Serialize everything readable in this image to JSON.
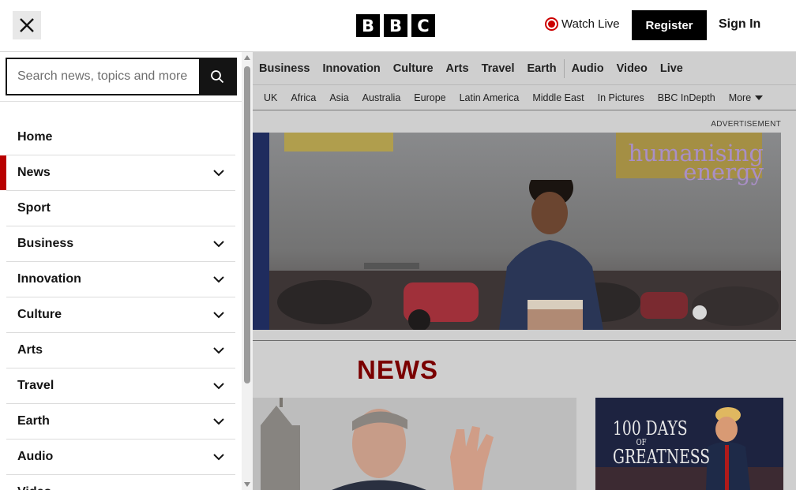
{
  "header": {
    "logo_letters": [
      "B",
      "B",
      "C"
    ],
    "watch_live": "Watch Live",
    "register": "Register",
    "sign_in": "Sign In"
  },
  "search": {
    "placeholder": "Search news, topics and more"
  },
  "menu": {
    "items": [
      {
        "label": "Home",
        "expandable": false,
        "active": false
      },
      {
        "label": "News",
        "expandable": true,
        "active": true
      },
      {
        "label": "Sport",
        "expandable": false,
        "active": false
      },
      {
        "label": "Business",
        "expandable": true,
        "active": false
      },
      {
        "label": "Innovation",
        "expandable": true,
        "active": false
      },
      {
        "label": "Culture",
        "expandable": true,
        "active": false
      },
      {
        "label": "Arts",
        "expandable": true,
        "active": false
      },
      {
        "label": "Travel",
        "expandable": true,
        "active": false
      },
      {
        "label": "Earth",
        "expandable": true,
        "active": false
      },
      {
        "label": "Audio",
        "expandable": true,
        "active": false
      },
      {
        "label": "Video",
        "expandable": false,
        "active": false
      }
    ]
  },
  "nav_primary": [
    "Business",
    "Innovation",
    "Culture",
    "Arts",
    "Travel",
    "Earth",
    "Audio",
    "Video",
    "Live"
  ],
  "nav_secondary": [
    "UK",
    "Africa",
    "Asia",
    "Australia",
    "Europe",
    "Latin America",
    "Middle East",
    "In Pictures",
    "BBC InDepth"
  ],
  "nav_more": "More",
  "advertisement": {
    "label": "ADVERTISEMENT",
    "headline_line1": "humanising",
    "headline_line2": "energy"
  },
  "section_title": "NEWS",
  "story2_text": [
    "100 DAYS",
    "OF",
    "GREATNESS"
  ],
  "colors": {
    "accent_red": "#b80000",
    "news_title": "#7a0000",
    "live_red": "#cc0000"
  }
}
